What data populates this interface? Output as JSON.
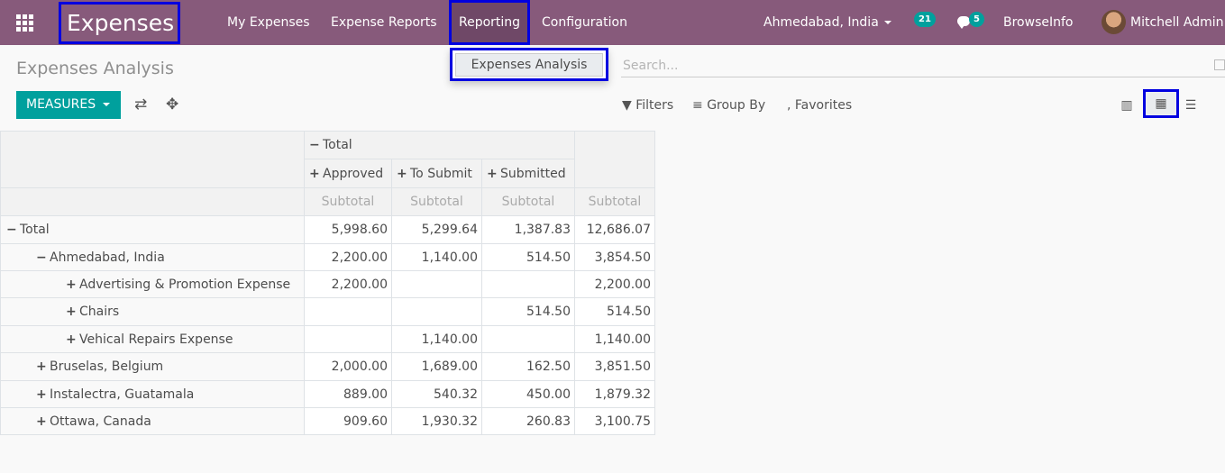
{
  "topbar": {
    "brand": "Expenses",
    "menu": [
      "My Expenses",
      "Expense Reports",
      "Reporting",
      "Configuration"
    ],
    "company": "Ahmedabad, India",
    "activity_count": "21",
    "message_count": "5",
    "browseinfo": "BrowseInfo",
    "user": "Mitchell Admin"
  },
  "dropdown": {
    "item": "Expenses Analysis"
  },
  "page": {
    "title": "Expenses Analysis"
  },
  "search": {
    "placeholder": "Search..."
  },
  "controls": {
    "measures": "MEASURES",
    "filters": "Filters",
    "group_by": "Group By",
    "favorites": "Favorites"
  },
  "pivot": {
    "col_total": "Total",
    "columns": [
      "Approved",
      "To Submit",
      "Submitted"
    ],
    "subtotal": "Subtotal",
    "rows": [
      {
        "sign": "−",
        "label": "Total",
        "values": [
          "5,998.60",
          "5,299.64",
          "1,387.83"
        ],
        "total": "12,686.07"
      },
      {
        "sign": "−",
        "label": "Ahmedabad, India",
        "values": [
          "2,200.00",
          "1,140.00",
          "514.50"
        ],
        "total": "3,854.50"
      },
      {
        "sign": "+",
        "label": "Advertising & Promotion Expense",
        "values": [
          "2,200.00",
          "",
          ""
        ],
        "total": "2,200.00"
      },
      {
        "sign": "+",
        "label": "Chairs",
        "values": [
          "",
          "",
          "514.50"
        ],
        "total": "514.50"
      },
      {
        "sign": "+",
        "label": "Vehical Repairs Expense",
        "values": [
          "",
          "1,140.00",
          ""
        ],
        "total": "1,140.00"
      },
      {
        "sign": "+",
        "label": "Bruselas, Belgium",
        "values": [
          "2,000.00",
          "1,689.00",
          "162.50"
        ],
        "total": "3,851.50"
      },
      {
        "sign": "+",
        "label": "Instalectra, Guatamala",
        "values": [
          "889.00",
          "540.32",
          "450.00"
        ],
        "total": "1,879.32"
      },
      {
        "sign": "+",
        "label": "Ottawa, Canada",
        "values": [
          "909.60",
          "1,930.32",
          "260.83"
        ],
        "total": "3,100.75"
      }
    ]
  }
}
